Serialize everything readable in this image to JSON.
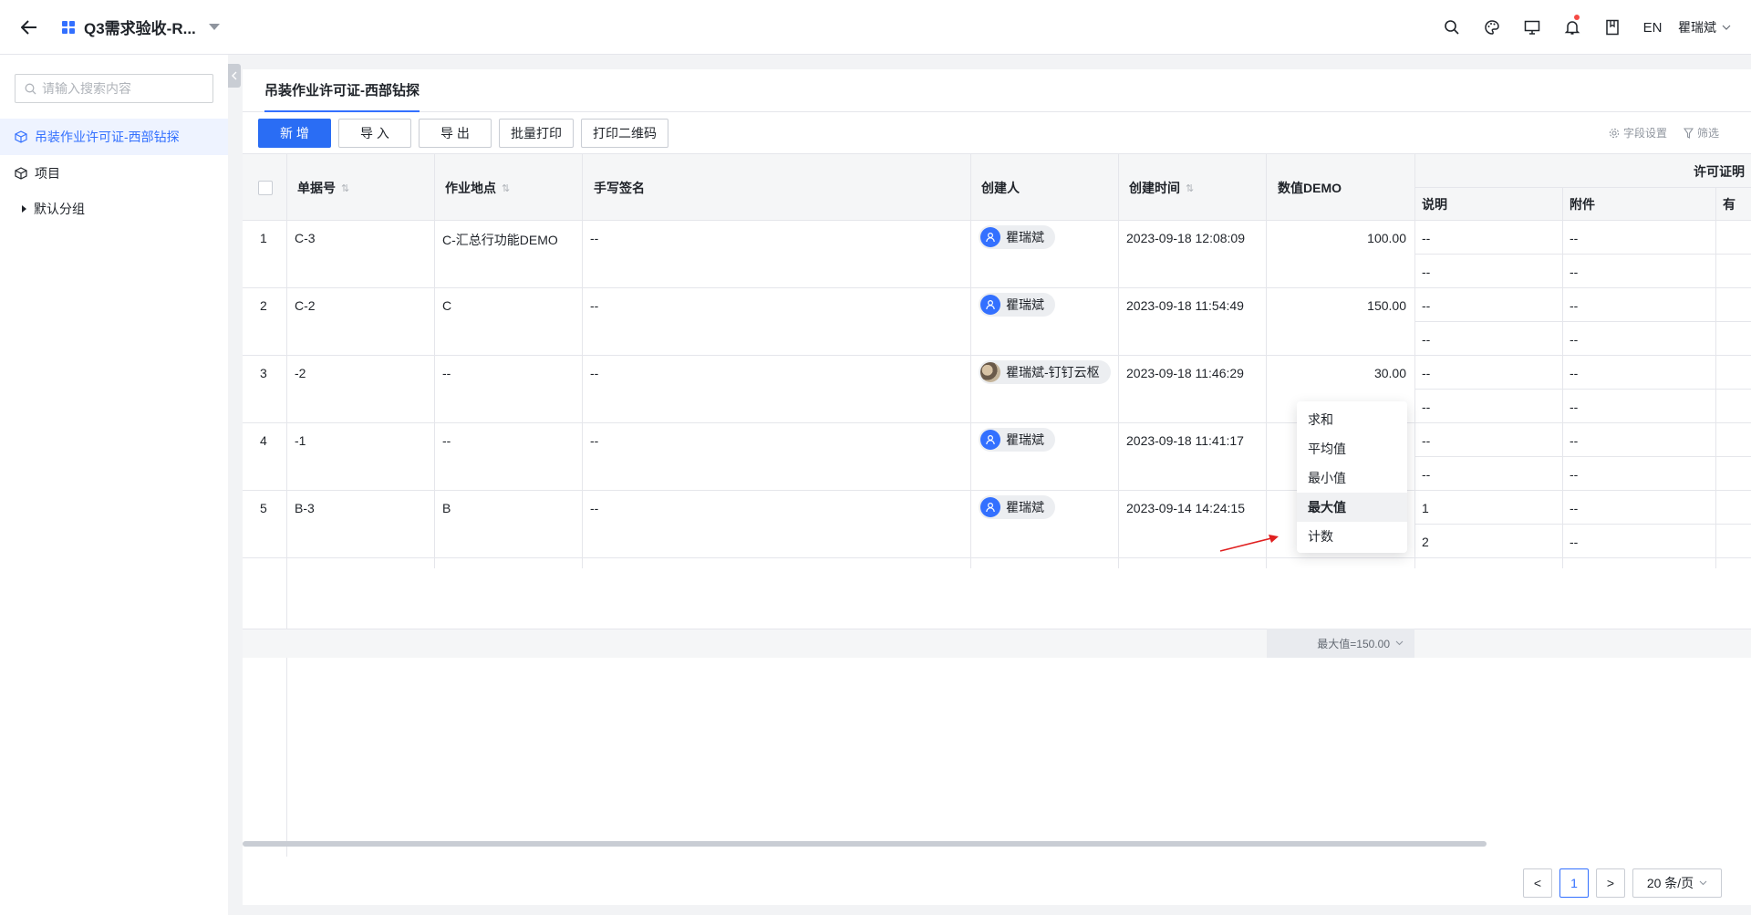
{
  "header": {
    "app_title": "Q3需求验收-R...",
    "lang": "EN",
    "user_name": "瞿瑞斌"
  },
  "sidebar": {
    "search_placeholder": "请输入搜索内容",
    "items": [
      {
        "label": "吊装作业许可证-西部钻探",
        "active": true
      },
      {
        "label": "项目",
        "active": false
      },
      {
        "label": "默认分组",
        "active": false
      }
    ]
  },
  "main": {
    "tab_label": "吊装作业许可证-西部钻探",
    "toolbar": {
      "add": "新 增",
      "import": "导 入",
      "export": "导 出",
      "batch_print": "批量打印",
      "print_qr": "打印二维码",
      "field_settings": "字段设置",
      "filter": "筛选"
    },
    "columns": {
      "doc_no": "单据号",
      "location": "作业地点",
      "signature": "手写签名",
      "creator": "创建人",
      "created_time": "创建时间",
      "numeric_demo": "数值DEMO",
      "permit_group": "许可证明",
      "desc": "说明",
      "attachment": "附件",
      "extra": "有"
    },
    "rows": [
      {
        "idx": "1",
        "doc_no": "C-3",
        "location": "C-汇总行功能DEMO",
        "signature": "--",
        "creator": "瞿瑞斌",
        "time": "2023-09-18 12:08:09",
        "value": "100.00",
        "sub": [
          {
            "desc": "--",
            "att": "--"
          },
          {
            "desc": "--",
            "att": "--"
          }
        ]
      },
      {
        "idx": "2",
        "doc_no": "C-2",
        "location": "C",
        "signature": "--",
        "creator": "瞿瑞斌",
        "time": "2023-09-18 11:54:49",
        "value": "150.00",
        "sub": [
          {
            "desc": "--",
            "att": "--"
          },
          {
            "desc": "--",
            "att": "--"
          }
        ]
      },
      {
        "idx": "3",
        "doc_no": "-2",
        "location": "--",
        "signature": "--",
        "creator": "瞿瑞斌-钉钉云枢",
        "time": "2023-09-18 11:46:29",
        "value": "30.00",
        "sub": [
          {
            "desc": "--",
            "att": "--"
          },
          {
            "desc": "--",
            "att": "--"
          }
        ]
      },
      {
        "idx": "4",
        "doc_no": "-1",
        "location": "--",
        "signature": "--",
        "creator": "瞿瑞斌",
        "time": "2023-09-18 11:41:17",
        "value": "",
        "sub": [
          {
            "desc": "--",
            "att": "--"
          },
          {
            "desc": "--",
            "att": "--"
          }
        ]
      },
      {
        "idx": "5",
        "doc_no": "B-3",
        "location": "B",
        "signature": "--",
        "creator": "瞿瑞斌",
        "time": "2023-09-14 14:24:15",
        "value": "",
        "sub": [
          {
            "desc": "1",
            "att": "--"
          },
          {
            "desc": "2",
            "att": "--"
          }
        ]
      }
    ],
    "summary": "最大值=150.00",
    "aggregate_menu": [
      "求和",
      "平均值",
      "最小值",
      "最大值",
      "计数"
    ],
    "aggregate_selected": "最大值",
    "pagination": {
      "prev": "<",
      "page": "1",
      "next": ">",
      "page_size": "20 条/页"
    }
  },
  "colors": {
    "accent": "#3370ff",
    "annotation": "#e02020"
  }
}
